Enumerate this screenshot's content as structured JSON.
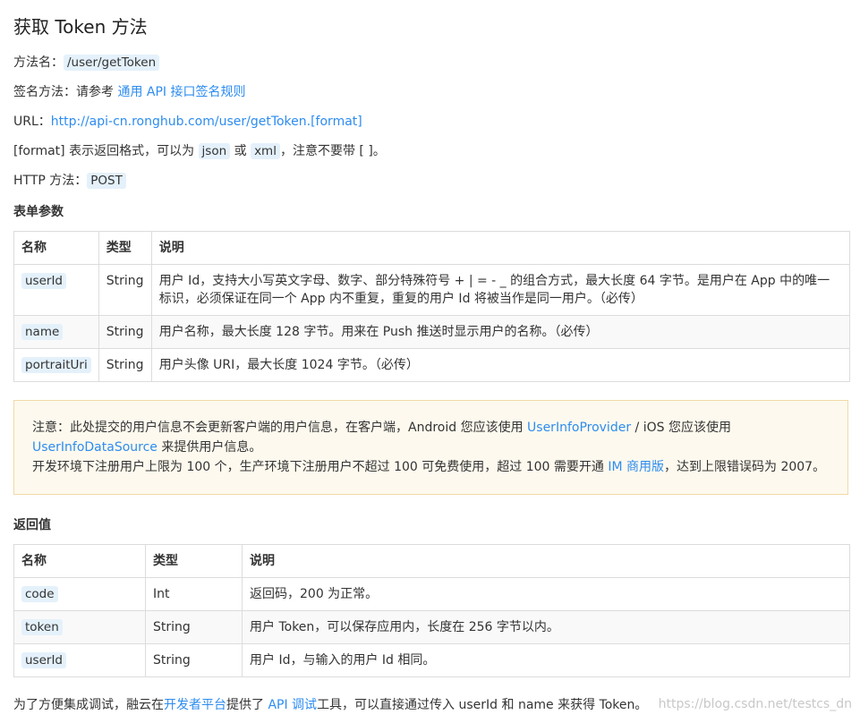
{
  "title": "获取 Token 方法",
  "method_name": {
    "label": "方法名：",
    "value": "/user/getToken"
  },
  "sign": {
    "label": "签名方法：请参考 ",
    "link": "通用 API 接口签名规则"
  },
  "url": {
    "label": "URL：",
    "link": "http://api-cn.ronghub.com/user/getToken.[format]"
  },
  "format": {
    "prefix": "[format] 表示返回格式，可以为 ",
    "json": "json",
    "or": " 或 ",
    "xml": "xml",
    "suffix": "，注意不要带 [ ]。"
  },
  "http": {
    "label": "HTTP 方法：",
    "value": "POST"
  },
  "form_title": "表单参数",
  "form_table": {
    "headers": [
      "名称",
      "类型",
      "说明"
    ],
    "rows": [
      {
        "name": "userId",
        "type": "String",
        "desc": "用户 Id，支持大小写英文字母、数字、部分特殊符号 + | = - _ 的组合方式，最大长度 64 字节。是用户在 App 中的唯一标识，必须保证在同一个 App 内不重复，重复的用户 Id 将被当作是同一用户。（必传）"
      },
      {
        "name": "name",
        "type": "String",
        "desc": "用户名称，最大长度 128 字节。用来在 Push 推送时显示用户的名称。（必传）"
      },
      {
        "name": "portraitUri",
        "type": "String",
        "desc": "用户头像 URI，最大长度 1024 字节。（必传）"
      }
    ]
  },
  "note": {
    "p1": "注意：此处提交的用户信息不会更新客户端的用户信息，在客户端，Android 您应该使用 ",
    "link1": "UserInfoProvider",
    "p2": " / iOS 您应该使用",
    "link2": "UserInfoDataSource",
    "p3": " 来提供用户信息。",
    "p4": "开发环境下注册用户上限为 100 个，生产环境下注册用户不超过 100 可免费使用，超过 100 需要开通 ",
    "link3": "IM 商用版",
    "p5": "，达到上限错误码为 2007。"
  },
  "return_title": "返回值",
  "return_table": {
    "headers": [
      "名称",
      "类型",
      "说明"
    ],
    "rows": [
      {
        "name": "code",
        "type": "Int",
        "desc": "返回码，200 为正常。"
      },
      {
        "name": "token",
        "type": "String",
        "desc": "用户 Token，可以保存应用内，长度在 256 字节以内。"
      },
      {
        "name": "userId",
        "type": "String",
        "desc": "用户 Id，与输入的用户 Id 相同。"
      }
    ]
  },
  "footer": {
    "p1": "为了方便集成调试，融云在",
    "link1": "开发者平台",
    "p2": "提供了 ",
    "link2": "API 调试",
    "p3": "工具，可以直接通过传入 userId 和 name 来获得 Token。"
  },
  "watermark": "https://blog.csdn.net/testcs_dn"
}
